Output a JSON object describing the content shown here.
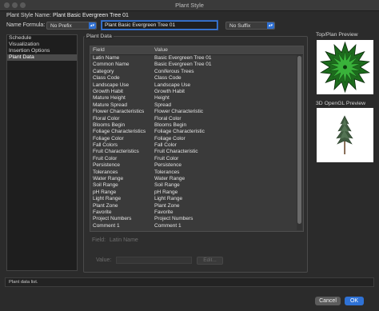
{
  "window": {
    "title": "Plant Style"
  },
  "header": {
    "plant_style_name_label": "Plant Style Name:",
    "plant_style_name_value": "Plant Basic Evergreen Tree 01",
    "name_formula_label": "Name Formula:",
    "prefix_select": "No Prefix",
    "name_input": "Plant Basic Evergreen Tree 01",
    "suffix_select": "No Suffix"
  },
  "sidebar": {
    "items": [
      {
        "label": "Schedule"
      },
      {
        "label": "Visualization"
      },
      {
        "label": "Insertion Options"
      },
      {
        "label": "Plant Data",
        "selected": true
      }
    ]
  },
  "plant_data": {
    "group_label": "Plant Data",
    "columns": {
      "field": "Field",
      "value": "Value"
    },
    "rows": [
      {
        "field": "Latin Name",
        "value": "Basic Evergreen Tree 01"
      },
      {
        "field": "Common Name",
        "value": "Basic Evergreen Tree 01"
      },
      {
        "field": "Category",
        "value": "Coniferous Trees"
      },
      {
        "field": "Class Code",
        "value": "Class Code"
      },
      {
        "field": "Landscape Use",
        "value": "Landscape Use"
      },
      {
        "field": "Growth Habit",
        "value": "Growth Habit"
      },
      {
        "field": "Mature Height",
        "value": "Height"
      },
      {
        "field": "Mature Spread",
        "value": "Spread"
      },
      {
        "field": "Flower Characteristics",
        "value": "Flower Characteristic"
      },
      {
        "field": "Floral Color",
        "value": "Floral Color"
      },
      {
        "field": "Blooms Begin",
        "value": "Blooms Begin"
      },
      {
        "field": "Foliage Characteristics",
        "value": "Foliage Characteristic"
      },
      {
        "field": "Foliage Color",
        "value": "Foliage Color"
      },
      {
        "field": "Fall Colors",
        "value": "Fall Color"
      },
      {
        "field": "Fruit Characteristics",
        "value": "Fruit Characteristic"
      },
      {
        "field": "Fruit Color",
        "value": "Fruit Color"
      },
      {
        "field": "Persistence",
        "value": "Persistence"
      },
      {
        "field": "Tolerances",
        "value": "Tolerances"
      },
      {
        "field": "Water Range",
        "value": "Water Range"
      },
      {
        "field": "Soil Range",
        "value": "Soil Range"
      },
      {
        "field": "pH Range",
        "value": "pH Range"
      },
      {
        "field": "Light Range",
        "value": "Light Range"
      },
      {
        "field": "Plant Zone",
        "value": "Plant Zone"
      },
      {
        "field": "Favorite",
        "value": "Favorite"
      },
      {
        "field": "Project Numbers",
        "value": "Project Numbers"
      },
      {
        "field": "Comment 1",
        "value": "Comment 1"
      }
    ],
    "field_label": "Field:",
    "field_value": "Latin Name",
    "value_label": "Value:",
    "value_input": "",
    "edit_button": "Edit..."
  },
  "previews": {
    "top_plan_label": "Top/Plan Preview",
    "opengl_label": "3D OpenGL Preview",
    "colors": {
      "leaf_dark": "#1d6b1d",
      "leaf_light": "#39b23a",
      "outline": "#0a2a0a"
    }
  },
  "status_bar": {
    "text": "Plant data list."
  },
  "footer": {
    "cancel_label": "Cancel",
    "ok_label": "OK"
  },
  "colors": {
    "accent": "#2f72d6",
    "background": "#2b2b2b"
  }
}
